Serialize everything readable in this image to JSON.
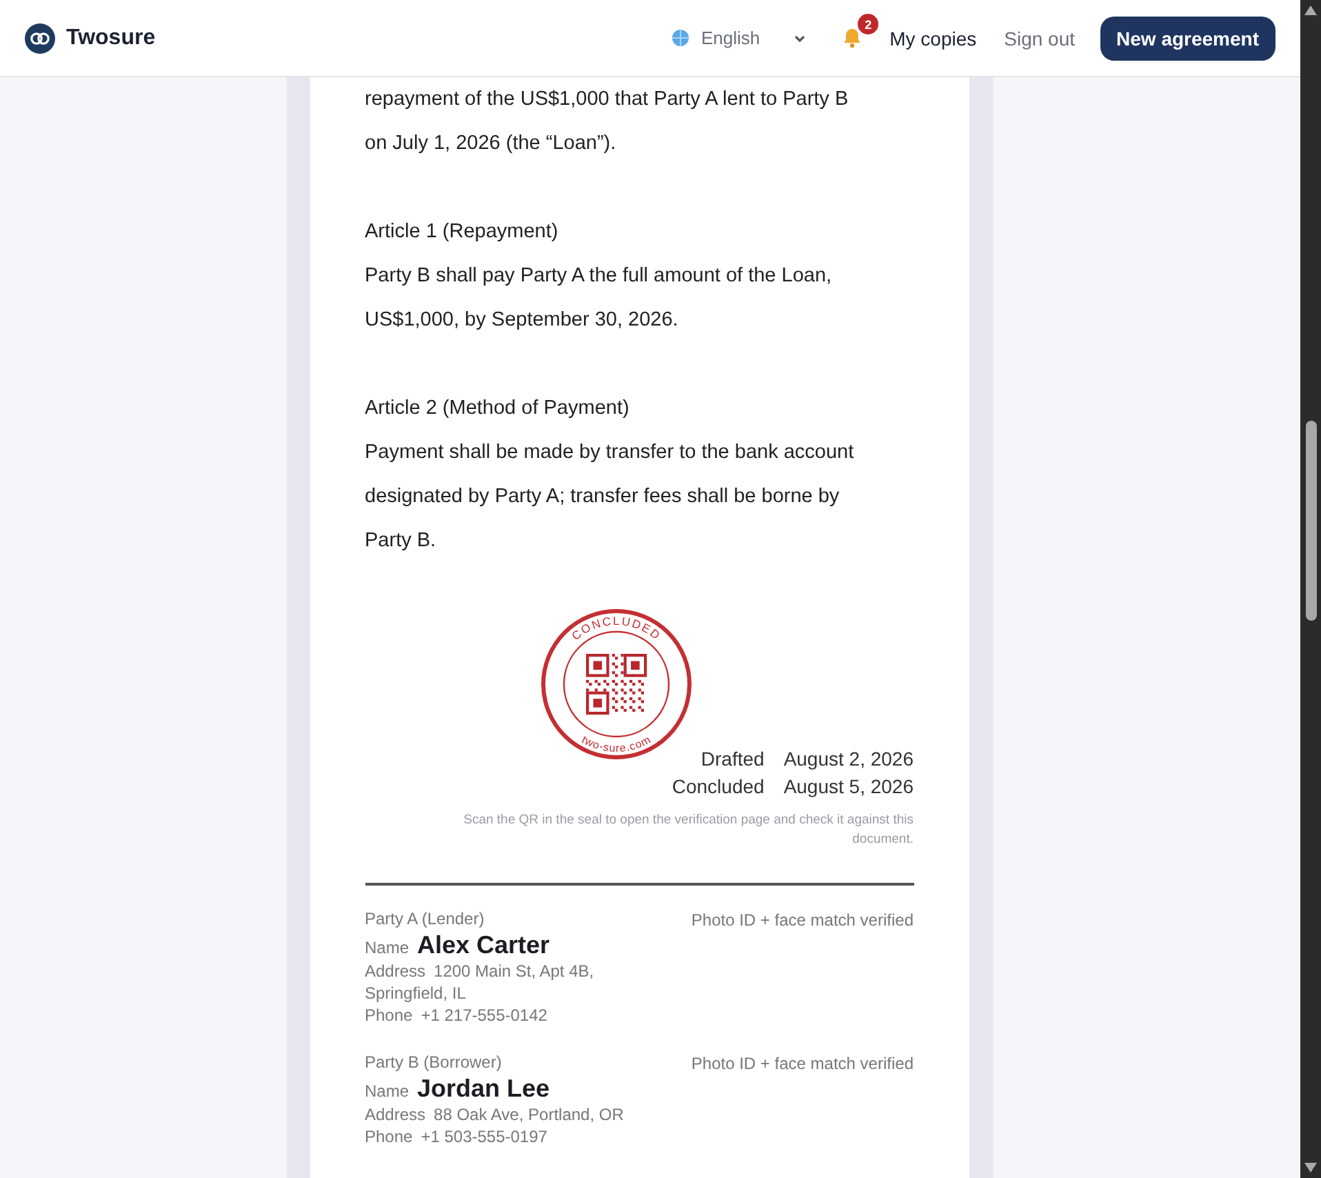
{
  "header": {
    "brand": "Twosure",
    "language": "English",
    "notification_count": "2",
    "links": [
      {
        "label": "My copies",
        "kind": "strong"
      },
      {
        "label": "Sign out",
        "kind": "muted"
      }
    ],
    "primary_button": "New agreement"
  },
  "document": {
    "intro": "repayment of the US$1,000 that Party A lent to Party B on July 1, 2026 (the “Loan”).",
    "articles": [
      {
        "title": "Article 1 (Repayment)",
        "body": "Party B shall pay Party A the full amount of the Loan, US$1,000, by September 30, 2026."
      },
      {
        "title": "Article 2 (Method of Payment)",
        "body": "Payment shall be made by transfer to the bank account designated by Party A; transfer fees shall be borne by Party B."
      }
    ],
    "seal": {
      "top_text": "CONCLUDED",
      "bottom_text": "two-sure.com"
    },
    "dates": [
      {
        "label": "Drafted",
        "value": "August 2, 2026"
      },
      {
        "label": "Concluded",
        "value": "August 5, 2026"
      }
    ],
    "note": "Scan the QR in the seal to open the verification page and check it against this document.",
    "parties": [
      {
        "role": "Party A (Lender)",
        "verification": "Photo ID + face match verified",
        "name_label": "Name",
        "name": "Alex Carter",
        "address_label": "Address",
        "address": "1200 Main St, Apt 4B, Springfield, IL",
        "phone_label": "Phone",
        "phone": "+1 217-555-0142"
      },
      {
        "role": "Party B (Borrower)",
        "verification": "Photo ID + face match verified",
        "name_label": "Name",
        "name": "Jordan Lee",
        "address_label": "Address",
        "address": "88 Oak Ave, Portland, OR",
        "phone_label": "Phone",
        "phone": "+1 503-555-0197"
      }
    ]
  }
}
